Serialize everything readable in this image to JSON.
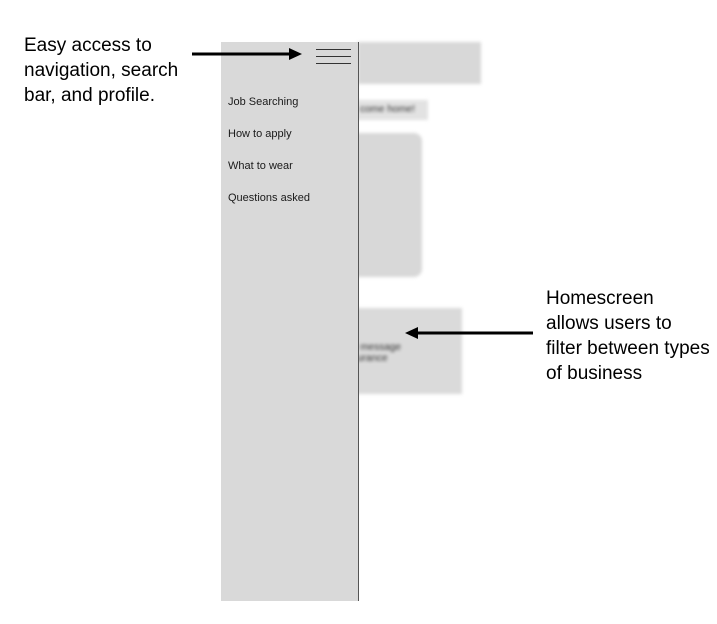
{
  "annotations": {
    "top_left": "Easy access to navigation, search bar, and profile.",
    "right": "Homescreen allows users to filter between types of business"
  },
  "background_screen": {
    "welcome_text": "come home!",
    "message_line_1": "e message",
    "message_line_2": "surance"
  },
  "drawer": {
    "menu_items": [
      "Job Searching",
      "How to apply",
      "What to wear",
      "Questions asked"
    ]
  },
  "icons": {
    "menu": "hamburger-menu-icon"
  },
  "colors": {
    "drawer_bg": "#d9d9d9",
    "placeholder_gray": "#d8d8d8",
    "arrow": "#000000"
  }
}
